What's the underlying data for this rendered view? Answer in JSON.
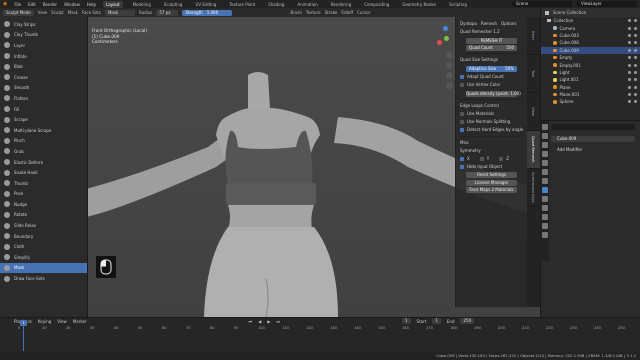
{
  "topbar": {
    "menus": [
      "File",
      "Edit",
      "Render",
      "Window",
      "Help"
    ],
    "workspaces": [
      "Layout",
      "Modeling",
      "Sculpting",
      "UV Editing",
      "Texture Paint",
      "Shading",
      "Animation",
      "Rendering",
      "Compositing",
      "Geometry Nodes",
      "Scripting"
    ],
    "active_workspace": "Layout",
    "scene": "Scene",
    "view_layer": "ViewLayer"
  },
  "tool_header": {
    "mode": "Sculpt Mode",
    "items": [
      "View",
      "Sculpt",
      "Mask",
      "Face Sets"
    ],
    "brush": "Mask",
    "radius_label": "Radius",
    "radius_value": "57 px",
    "strength_label": "Strength",
    "strength_value": "1.000",
    "right_items": [
      "Brush",
      "Texture",
      "Stroke",
      "Falloff",
      "Cursor"
    ]
  },
  "brushes": [
    "Clay Strips",
    "Clay Thumb",
    "Layer",
    "Inflate",
    "Blob",
    "Crease",
    "Smooth",
    "Flatten",
    "Fill",
    "Scrape",
    "Multi-plane Scrape",
    "Pinch",
    "Grab",
    "Elastic Deform",
    "Snake Hook",
    "Thumb",
    "Pose",
    "Nudge",
    "Rotate",
    "Slide Relax",
    "Boundary",
    "Cloth",
    "Simplify",
    "Mask",
    "Draw Face Sets"
  ],
  "active_brush": "Mask",
  "viewport": {
    "view_name": "Front Orthographic (Local)",
    "object": "(1) Cube.009",
    "units": "Centimeters"
  },
  "npanel": {
    "header": [
      "Dyntopo",
      "Remesh",
      "Options"
    ],
    "title": "Quad Remesher 1.2",
    "license": "REMESH IT",
    "quad_count_label": "Quad Count",
    "quad_count_value": "500",
    "settings_title": "Quad Size Settings",
    "adaptive_label": "Adaptive Size",
    "adaptive_value": "50%",
    "adapt_quad_count": "Adapt Quad Count",
    "use_vertex_color": "Use Vertex Color",
    "density_label": "Quads density (paint: 1.00)",
    "edge_loops_title": "Edge Loops Control",
    "use_materials": "Use Materials",
    "use_normals": "Use Normals Splitting",
    "detect_edges": "Detect Hard Edges by angle",
    "misc_title": "Misc",
    "symmetry_title": "Symmetry",
    "sym_x": "X",
    "sym_y": "Y",
    "sym_z": "Z",
    "hide_input": "Hide Input Object",
    "reset_settings": "Reset Settings",
    "license_manager": "License Manager",
    "face_maps": "Face Maps 2 Materials"
  },
  "vertical_tabs": [
    "Item",
    "Tool",
    "View",
    "Quad Remesh",
    "Screencast Keys"
  ],
  "outliner": {
    "title": "Scene Collection",
    "rows": [
      {
        "label": "Collection",
        "type": "coll"
      },
      {
        "label": "Camera",
        "type": "cam"
      },
      {
        "label": "Cube.003",
        "type": "obj"
      },
      {
        "label": "Cube.008",
        "type": "obj"
      },
      {
        "label": "Cube.009",
        "type": "obj"
      },
      {
        "label": "Empty",
        "type": "obj"
      },
      {
        "label": "Empty.001",
        "type": "obj"
      },
      {
        "label": "Light",
        "type": "light"
      },
      {
        "label": "Light.001",
        "type": "light"
      },
      {
        "label": "Plane",
        "type": "obj"
      },
      {
        "label": "Plane.001",
        "type": "obj"
      },
      {
        "label": "Sphere",
        "type": "obj"
      }
    ],
    "selected": "Cube.009"
  },
  "properties": {
    "object_name": "Cube.009",
    "add_modifier": "Add Modifier"
  },
  "timeline": {
    "menus": [
      "Playback",
      "Keying",
      "View",
      "Marker"
    ],
    "current_frame": "1",
    "start_label": "Start",
    "start_value": "1",
    "end_label": "End",
    "end_value": "250",
    "ticks": [
      "0",
      "10",
      "20",
      "30",
      "40",
      "50",
      "60",
      "70",
      "80",
      "90",
      "100",
      "110",
      "120",
      "130",
      "140",
      "150",
      "160",
      "170",
      "180",
      "190",
      "200",
      "210",
      "220",
      "230",
      "240",
      "250"
    ]
  },
  "statusbar": {
    "text": "Cube.009 | Verts:130,183 | Faces:267,432 | Objects:1/10 | Memory: 202.1 MiB | VRAM: 1.3/8.0 GiB | 3.1.2"
  },
  "colors": {
    "accent": "#4772b3",
    "object_orange": "#e0902a",
    "body": "#aaaaaa",
    "top_garment": "#555555"
  }
}
